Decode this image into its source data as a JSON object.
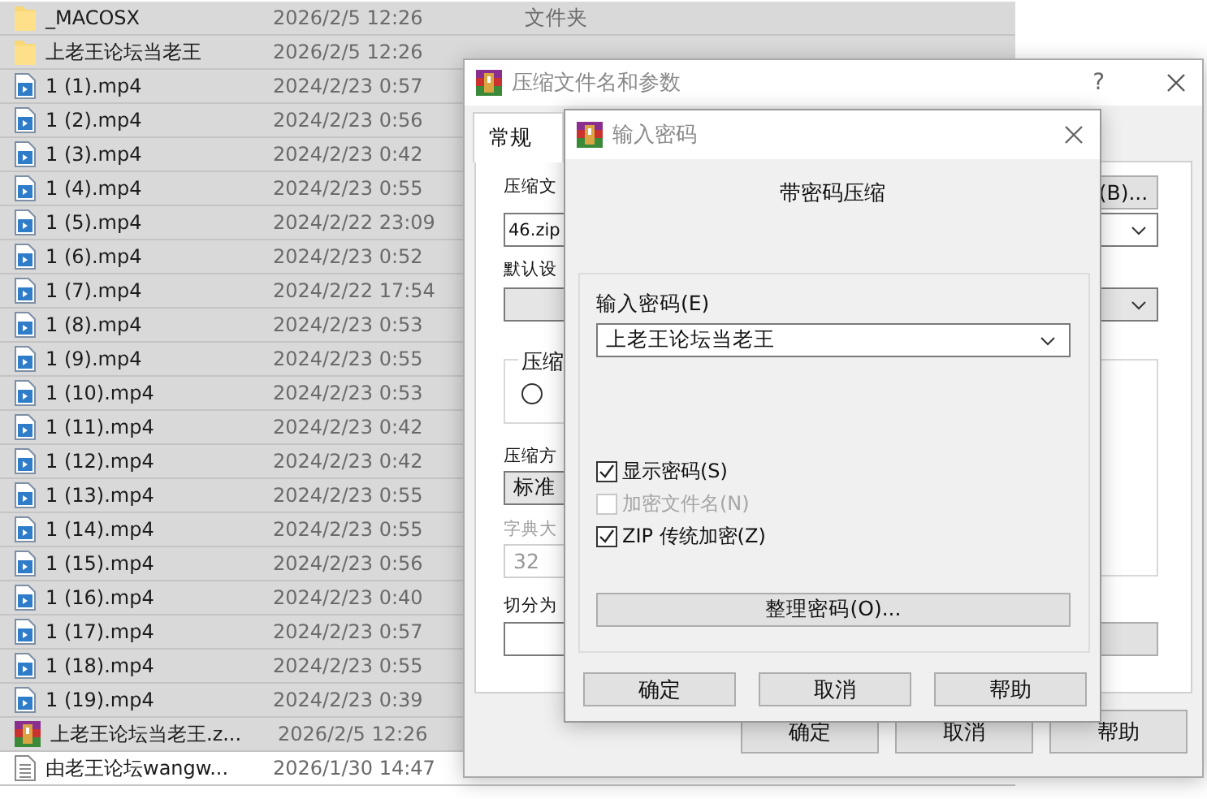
{
  "file_list": {
    "rows": [
      {
        "kind": "folder",
        "name": "_MACOSX",
        "modified": "2026/2/5 12:26",
        "type": "文件夹",
        "selected": true
      },
      {
        "kind": "folder",
        "name": "上老王论坛当老王",
        "modified": "2026/2/5 12:26",
        "selected": true
      },
      {
        "kind": "video",
        "name": "1 (1).mp4",
        "modified": "2024/2/23 0:57",
        "selected": true
      },
      {
        "kind": "video",
        "name": "1 (2).mp4",
        "modified": "2024/2/23 0:56",
        "selected": true
      },
      {
        "kind": "video",
        "name": "1 (3).mp4",
        "modified": "2024/2/23 0:42",
        "selected": true
      },
      {
        "kind": "video",
        "name": "1 (4).mp4",
        "modified": "2024/2/23 0:55",
        "selected": true
      },
      {
        "kind": "video",
        "name": "1 (5).mp4",
        "modified": "2024/2/22 23:09",
        "selected": true
      },
      {
        "kind": "video",
        "name": "1 (6).mp4",
        "modified": "2024/2/23 0:52",
        "selected": true
      },
      {
        "kind": "video",
        "name": "1 (7).mp4",
        "modified": "2024/2/22 17:54",
        "selected": true
      },
      {
        "kind": "video",
        "name": "1 (8).mp4",
        "modified": "2024/2/23 0:53",
        "selected": true
      },
      {
        "kind": "video",
        "name": "1 (9).mp4",
        "modified": "2024/2/23 0:55",
        "selected": true
      },
      {
        "kind": "video",
        "name": "1 (10).mp4",
        "modified": "2024/2/23 0:53",
        "selected": true
      },
      {
        "kind": "video",
        "name": "1 (11).mp4",
        "modified": "2024/2/23 0:42",
        "selected": true
      },
      {
        "kind": "video",
        "name": "1 (12).mp4",
        "modified": "2024/2/23 0:42",
        "selected": true
      },
      {
        "kind": "video",
        "name": "1 (13).mp4",
        "modified": "2024/2/23 0:55",
        "selected": true
      },
      {
        "kind": "video",
        "name": "1 (14).mp4",
        "modified": "2024/2/23 0:55",
        "selected": true
      },
      {
        "kind": "video",
        "name": "1 (15).mp4",
        "modified": "2024/2/23 0:56",
        "selected": true
      },
      {
        "kind": "video",
        "name": "1 (16).mp4",
        "modified": "2024/2/23 0:40",
        "selected": true
      },
      {
        "kind": "video",
        "name": "1 (17).mp4",
        "modified": "2024/2/23 0:57",
        "selected": true
      },
      {
        "kind": "video",
        "name": "1 (18).mp4",
        "modified": "2024/2/23 0:55",
        "selected": true
      },
      {
        "kind": "video",
        "name": "1 (19).mp4",
        "modified": "2024/2/23 0:39",
        "selected": true
      },
      {
        "kind": "archive",
        "name": "上老王论坛当老王.z...",
        "modified": "2026/2/5 12:26",
        "selected": true
      },
      {
        "kind": "text",
        "name": "由老王论坛wangw...",
        "modified": "2026/1/30 14:47",
        "selected": false
      }
    ]
  },
  "compress_dialog": {
    "title": "压缩文件名和参数",
    "help": "?",
    "tabs": [
      {
        "label": "常规",
        "selected": true
      }
    ],
    "archive_name_label": "压缩文",
    "archive_name": "46.zip",
    "browse_button": "(B)...",
    "profile_label": "默认设",
    "format_group_label": "压缩",
    "format_option": {
      "selected": false
    },
    "method": {
      "label": "压缩方",
      "value": "标准"
    },
    "dictionary": {
      "label": "字典大",
      "value": "32",
      "disabled": true
    },
    "split_label": "切分为",
    "buttons": [
      "确定",
      "取消",
      "帮助"
    ]
  },
  "password_dialog": {
    "title": "输入密码",
    "heading": "带密码压缩",
    "password_label": "输入密码(E)",
    "password": "上老王论坛当老王",
    "options": [
      {
        "label": "显示密码(S)",
        "checked": true,
        "disabled": false
      },
      {
        "label": "加密文件名(N)",
        "checked": false,
        "disabled": true
      },
      {
        "label": "ZIP 传统加密(Z)",
        "checked": true,
        "disabled": false
      }
    ],
    "organize_button": "整理密码(O)...",
    "buttons": [
      "确定",
      "取消",
      "帮助"
    ]
  }
}
